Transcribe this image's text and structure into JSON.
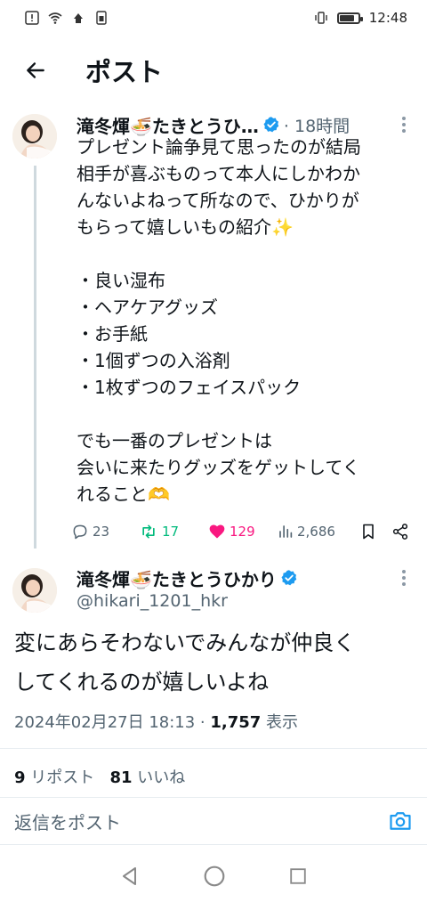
{
  "status_bar": {
    "time": "12:48"
  },
  "header": {
    "title": "ポスト"
  },
  "tweet1": {
    "name": "滝冬煇🍜たきとうひ…",
    "time": "· 18時間",
    "lines": [
      "プレゼント論争見て思ったのが結局",
      "相手が喜ぶものって本人にしかわか",
      "んないよねって所なので、ひかりが",
      "もらって嬉しいもの紹介",
      "",
      "・良い湿布",
      "・ヘアケアグッズ",
      "・お手紙",
      "・1個ずつの入浴剤",
      "・1枚ずつのフェイスパック",
      "",
      "でも一番のプレゼントは",
      "会いに来たりグッズをゲットしてく",
      "れること"
    ],
    "sparkle": "✨",
    "heart_hands": "🫶",
    "replies": "23",
    "reposts": "17",
    "likes": "129",
    "views": "2,686"
  },
  "tweet2": {
    "name": "滝冬煇🍜たきとうひかり",
    "handle": "@hikari_1201_hkr",
    "lines": [
      "変にあらそわないでみんなが仲良く",
      "してくれるのが嬉しいよね"
    ],
    "datetime": "2024年02月27日 18:13 · ",
    "views_count": "1,757",
    "views_label": " 表示",
    "repost_count": "9",
    "repost_label": " リポスト",
    "like_count": "81",
    "like_label": " いいね"
  },
  "reply_bar": {
    "placeholder": "返信をポスト"
  },
  "colors": {
    "verified": "#1d9bf0",
    "repost": "#00ba7c",
    "like": "#f91880",
    "muted": "#536471"
  },
  "icons": [
    "back-arrow-icon",
    "verified-icon",
    "more-icon",
    "reply-icon",
    "repost-icon",
    "heart-icon",
    "views-icon",
    "bookmark-icon",
    "share-icon",
    "camera-icon",
    "nav-back-icon",
    "nav-home-icon",
    "nav-recents-icon"
  ]
}
